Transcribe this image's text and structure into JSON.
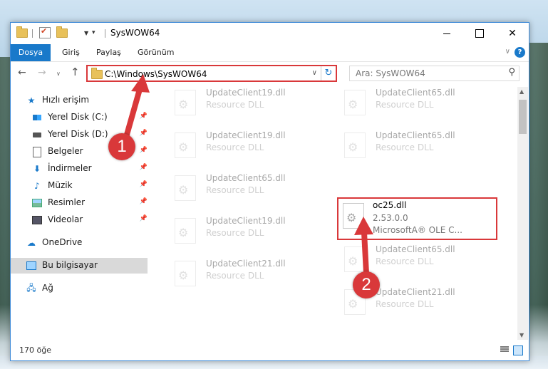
{
  "window": {
    "title": "SysWOW64"
  },
  "ribbon": {
    "tabs": [
      {
        "label": "Dosya",
        "active": true
      },
      {
        "label": "Giriş"
      },
      {
        "label": "Paylaş"
      },
      {
        "label": "Görünüm"
      }
    ],
    "help": "?"
  },
  "nav": {
    "address": "C:\\Windows\\SysWOW64",
    "search_placeholder": "Ara: SysWOW64"
  },
  "sidebar": {
    "quick_access": "Hızlı erişim",
    "items": [
      {
        "label": "Yerel Disk (C:)",
        "icon": "windows-drive-icon"
      },
      {
        "label": "Yerel Disk (D:)",
        "icon": "drive-icon"
      },
      {
        "label": "Belgeler",
        "icon": "documents-icon"
      },
      {
        "label": "İndirmeler",
        "icon": "download-icon"
      },
      {
        "label": "Müzik",
        "icon": "music-icon"
      },
      {
        "label": "Resimler",
        "icon": "pictures-icon"
      },
      {
        "label": "Videolar",
        "icon": "videos-icon"
      }
    ],
    "onedrive": "OneDrive",
    "this_pc": "Bu bilgisayar",
    "network": "Ağ"
  },
  "files": {
    "col1": [
      {
        "name": "UpdateClient19.dll",
        "desc": "Resource DLL"
      },
      {
        "name": "UpdateClient19.dll",
        "desc": "Resource DLL"
      },
      {
        "name": "UpdateClient65.dll",
        "desc": "Resource DLL"
      },
      {
        "name": "UpdateClient19.dll",
        "desc": "Resource DLL"
      },
      {
        "name": "UpdateClient21.dll",
        "desc": "Resource DLL"
      }
    ],
    "col2": [
      {
        "name": "UpdateClient65.dll",
        "desc": "Resource DLL"
      },
      {
        "name": "UpdateClient65.dll",
        "desc": "Resource DLL"
      },
      {
        "name": "UpdateClient65.dll",
        "desc": "Resource DLL"
      },
      {
        "name": "UpdateClient21.dll",
        "desc": "Resource DLL"
      }
    ],
    "highlighted": {
      "name": "oc25.dll",
      "version": "2.53.0.0",
      "company": "MicrosoftA® OLE C..."
    }
  },
  "status": {
    "count": "170 öğe"
  },
  "annotations": {
    "step1": "1",
    "step2": "2",
    "color": "#d9383a"
  }
}
